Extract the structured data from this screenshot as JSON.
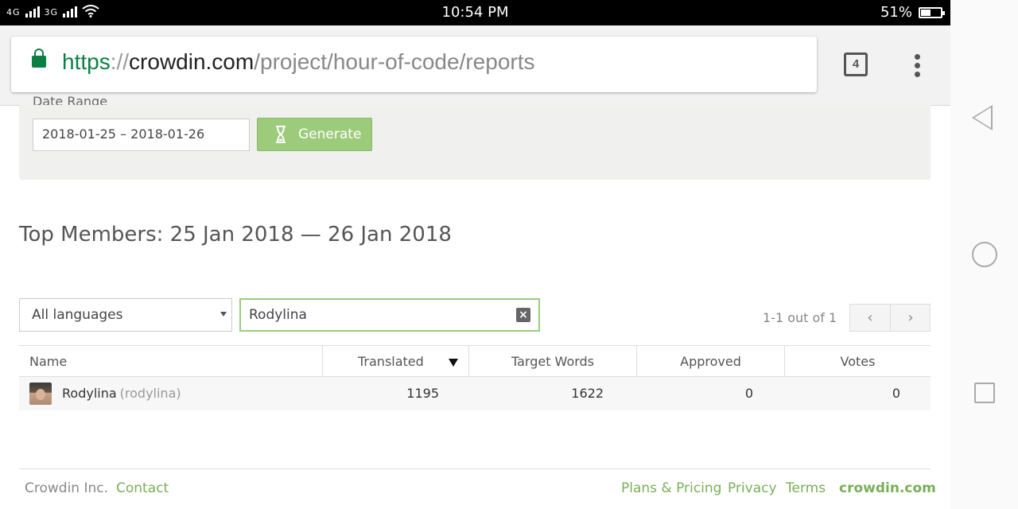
{
  "status_bar": {
    "network_left": "4G",
    "network_right": "3G",
    "time": "10:54 PM",
    "battery": "51%",
    "battery_level": 0.51
  },
  "browser": {
    "url_scheme": "https",
    "url_sep": "://",
    "url_host": "crowdin.com",
    "url_path": "/project/hour-of-code/reports",
    "tab_count": "4"
  },
  "report": {
    "date_range_label": "Date Range",
    "date_range_value": "2018-01-25 – 2018-01-26",
    "generate_label": "Generate",
    "heading": "Top Members: 25 Jan 2018 — 26 Jan 2018"
  },
  "filters": {
    "language_selected": "All languages",
    "search_value": "Rodylina",
    "page_info": "1-1 out of 1",
    "prev_icon": "‹",
    "next_icon": "›"
  },
  "table": {
    "columns": [
      "Name",
      "Translated",
      "Target Words",
      "Approved",
      "Votes"
    ],
    "rows": [
      {
        "name": "Rodylina",
        "login": "(rodylina)",
        "translated": "1195",
        "target_words": "1622",
        "approved": "0",
        "votes": "0"
      }
    ]
  },
  "footer": {
    "company": "Crowdin Inc.",
    "contact": "Contact",
    "plans": "Plans & Pricing",
    "privacy": "Privacy",
    "terms": "Terms",
    "brand": "crowdin.com"
  },
  "colors": {
    "accent_green": "#7aae58",
    "button_green": "#9ccb7c",
    "secure_green": "#0b8043"
  }
}
